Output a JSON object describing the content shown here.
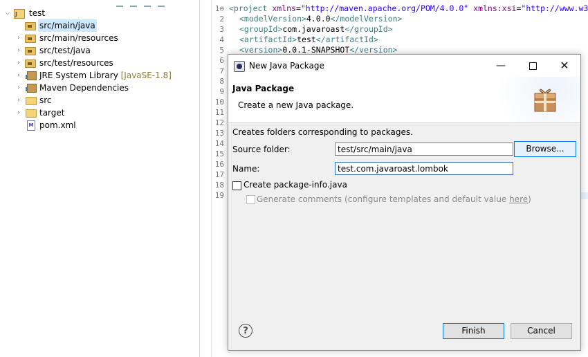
{
  "explorer": {
    "items": [
      {
        "label": "test",
        "decoration": "",
        "icon": "project-icon"
      },
      {
        "label": "src/main/java",
        "decoration": "",
        "icon": "package-folder-icon"
      },
      {
        "label": "src/main/resources",
        "decoration": "",
        "icon": "package-folder-icon"
      },
      {
        "label": "src/test/java",
        "decoration": "",
        "icon": "package-folder-icon"
      },
      {
        "label": "src/test/resources",
        "decoration": "",
        "icon": "package-folder-icon"
      },
      {
        "label": "JRE System Library",
        "decoration": "[JavaSE-1.8]",
        "icon": "library-icon"
      },
      {
        "label": "Maven Dependencies",
        "decoration": "",
        "icon": "library-icon"
      },
      {
        "label": "src",
        "decoration": "",
        "icon": "folder-icon"
      },
      {
        "label": "target",
        "decoration": "",
        "icon": "folder-icon"
      },
      {
        "label": "pom.xml",
        "decoration": "",
        "icon": "maven-file-icon"
      }
    ]
  },
  "editor": {
    "line_numbers": [
      "1⊖",
      "2",
      "3",
      "4",
      "5",
      "6",
      "7",
      "8",
      "9",
      "10",
      "11",
      "12",
      "13",
      "14",
      "15",
      "16",
      "17",
      "18",
      "19"
    ],
    "code": {
      "l1_tag": "<project",
      "l1_attr1": " xmlns",
      "l1_eq1": "=",
      "l1_str1": "\"http://maven.apache.org/POM/4.0.0\"",
      "l1_attr2": " xmlns:xsi",
      "l1_eq2": "=",
      "l1_str2": "\"http://www.w3",
      "l2_open": "<modelVersion>",
      "l2_text": "4.0.0",
      "l2_close": "</modelVersion>",
      "l3_open": "<groupId>",
      "l3_text": "com.javaroast",
      "l3_close": "</groupId>",
      "l4_open": "<artifactId>",
      "l4_text": "test",
      "l4_close": "</artifactId>",
      "l5_open": "<version>",
      "l5_text": "0.0.1-SNAPSHOT",
      "l5_close": "</version>"
    }
  },
  "dialog": {
    "window_title": "New Java Package",
    "minimize_glyph": "—",
    "close_glyph": "✕",
    "banner_title": "Java Package",
    "banner_description": "Create a new Java package.",
    "info_text": "Creates folders corresponding to packages.",
    "source_folder_label": "Source folder:",
    "source_folder_value": "test/src/main/java",
    "browse_label": "Browse...",
    "name_label": "Name:",
    "name_value": "test.com.javaroast.lombok",
    "create_package_info_label": "Create package-info.java",
    "create_package_info_checked": false,
    "generate_comments_label": "Generate comments (configure templates and default value ",
    "generate_comments_link": "here",
    "generate_comments_suffix": ")",
    "generate_comments_enabled": false,
    "help_glyph": "?",
    "finish_label": "Finish",
    "cancel_label": "Cancel"
  }
}
